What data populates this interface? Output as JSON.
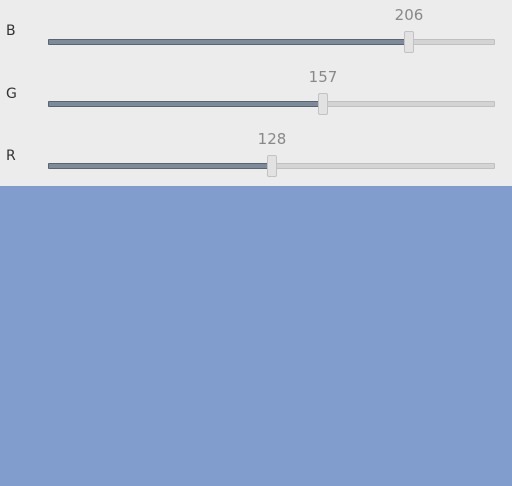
{
  "sliders": [
    {
      "label": "B",
      "value": "206",
      "fraction": 0.808
    },
    {
      "label": "G",
      "value": "157",
      "fraction": 0.616
    },
    {
      "label": "R",
      "value": "128",
      "fraction": 0.502
    }
  ],
  "min": 0,
  "max": 255,
  "swatch_color": "#809dcd"
}
